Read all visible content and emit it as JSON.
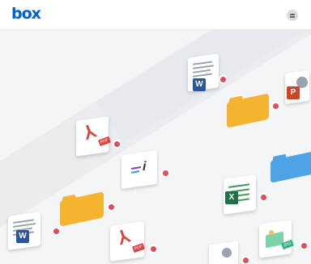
{
  "header": {
    "logo_text": "box",
    "logo_color": "#0061d5",
    "menu_icon": "menu-icon"
  },
  "hero": {
    "files": [
      {
        "type": "word",
        "label": "W",
        "icon": "word-doc-icon"
      },
      {
        "type": "folder",
        "color": "#f5b430",
        "icon": "folder-icon"
      },
      {
        "type": "powerpoint",
        "label": "P",
        "icon": "powerpoint-icon"
      },
      {
        "type": "pdf",
        "label": "PDF",
        "icon": "pdf-icon"
      },
      {
        "type": "notes",
        "label": "i",
        "icon": "box-notes-icon"
      },
      {
        "type": "folder",
        "color": "#4da3e6",
        "icon": "folder-icon"
      },
      {
        "type": "folder",
        "color": "#f5b430",
        "icon": "folder-icon"
      },
      {
        "type": "excel",
        "label": "X",
        "icon": "excel-icon"
      },
      {
        "type": "word",
        "label": "W",
        "icon": "word-doc-icon"
      },
      {
        "type": "pdf",
        "label": "PDF",
        "icon": "pdf-icon"
      },
      {
        "type": "image",
        "label": "JPG",
        "icon": "jpg-image-icon"
      }
    ]
  }
}
